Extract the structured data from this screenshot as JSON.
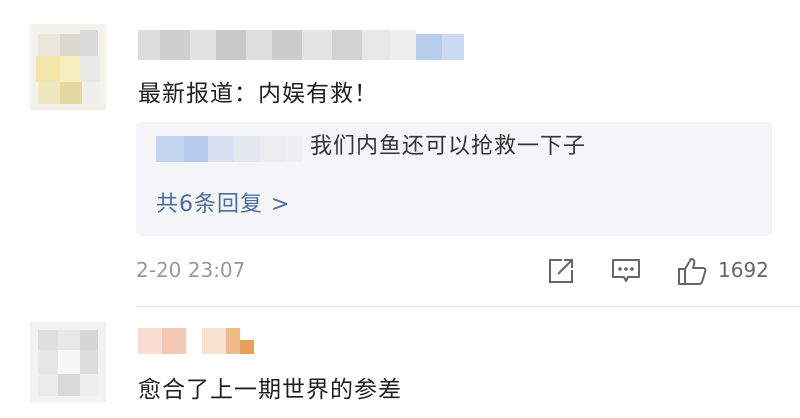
{
  "comments": [
    {
      "text": "最新报道：内娱有救！",
      "reply_preview": "我们内鱼还可以抢救一下子",
      "reply_link": "共6条回复 >",
      "timestamp": "2-20 23:07",
      "like_count": "1692",
      "icons": [
        "share-icon",
        "comment-icon",
        "like-icon"
      ]
    },
    {
      "text": "愈合了上一期世界的参差"
    }
  ],
  "colors": {
    "link": "#4a6ea4",
    "reply_bg": "#f5f5f7",
    "meta_gray": "#999999"
  }
}
